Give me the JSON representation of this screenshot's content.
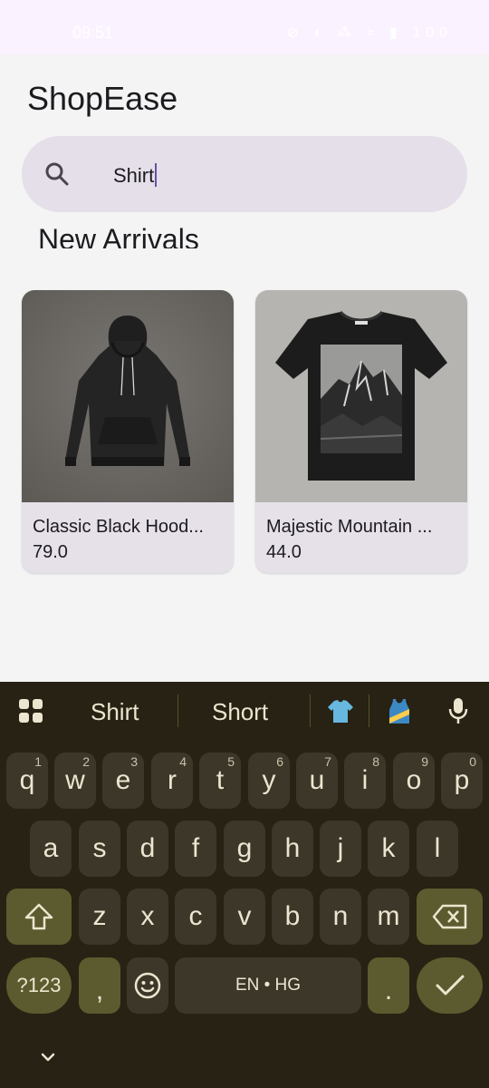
{
  "status_bar": {
    "time": "09:51",
    "icons_text": "⊘ ◐ ⁂ ≈ ▮ 100"
  },
  "app": {
    "title": "ShopEase",
    "search": {
      "value": "Shirt"
    },
    "section_title": "New Arrivals",
    "products": [
      {
        "name": "Classic Black Hood...",
        "price": "79.0",
        "image": "black-hoodie"
      },
      {
        "name": "Majestic Mountain ...",
        "price": "44.0",
        "image": "mountain-tshirt"
      }
    ]
  },
  "keyboard": {
    "suggestions": [
      "Shirt",
      "Short"
    ],
    "row1": [
      {
        "key": "q",
        "hint": "1"
      },
      {
        "key": "w",
        "hint": "2"
      },
      {
        "key": "e",
        "hint": "3"
      },
      {
        "key": "r",
        "hint": "4"
      },
      {
        "key": "t",
        "hint": "5"
      },
      {
        "key": "y",
        "hint": "6"
      },
      {
        "key": "u",
        "hint": "7"
      },
      {
        "key": "i",
        "hint": "8"
      },
      {
        "key": "o",
        "hint": "9"
      },
      {
        "key": "p",
        "hint": "0"
      }
    ],
    "row2": [
      "a",
      "s",
      "d",
      "f",
      "g",
      "h",
      "j",
      "k",
      "l"
    ],
    "row3": [
      "z",
      "x",
      "c",
      "v",
      "b",
      "n",
      "m"
    ],
    "symbols_label": "?123",
    "comma_label": ",",
    "space_label": "EN • HG",
    "period_label": "."
  },
  "colors": {
    "accent": "#6750a4",
    "search_bg": "#e5dfea",
    "keyboard_bg": "#272213",
    "key_bg": "#3d372a",
    "special_key_bg": "#5c5b2f"
  }
}
